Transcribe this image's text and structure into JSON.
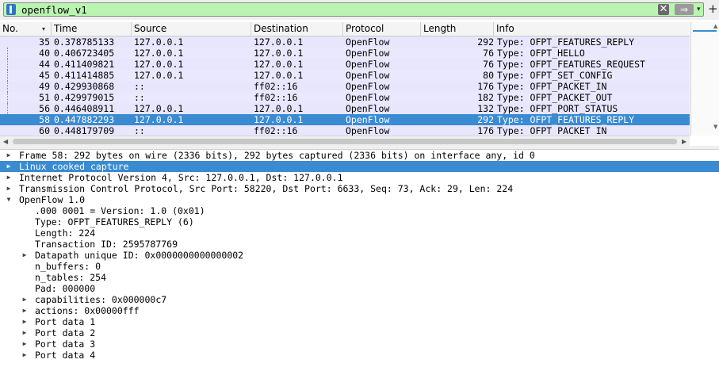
{
  "filter": {
    "value": "openflow_v1",
    "bookmark_icon": "bookmark-icon",
    "clear_glyph": "✕",
    "apply_glyph": "⇒",
    "dropdown_glyph": "▾",
    "plus_glyph": "+"
  },
  "packet_list": {
    "columns": [
      "No.",
      "Time",
      "Source",
      "Destination",
      "Protocol",
      "Length",
      "Info"
    ],
    "sort_glyph": "▾",
    "rows": [
      {
        "no": "35",
        "time": "0.378785133",
        "src": "127.0.0.1",
        "dst": "127.0.0.1",
        "proto": "OpenFlow",
        "len": "292",
        "info": "Type: OFPT_FEATURES_REPLY"
      },
      {
        "no": "40",
        "time": "0.406723405",
        "src": "127.0.0.1",
        "dst": "127.0.0.1",
        "proto": "OpenFlow",
        "len": "76",
        "info": "Type: OFPT_HELLO"
      },
      {
        "no": "44",
        "time": "0.411409821",
        "src": "127.0.0.1",
        "dst": "127.0.0.1",
        "proto": "OpenFlow",
        "len": "76",
        "info": "Type: OFPT_FEATURES_REQUEST"
      },
      {
        "no": "45",
        "time": "0.411414885",
        "src": "127.0.0.1",
        "dst": "127.0.0.1",
        "proto": "OpenFlow",
        "len": "80",
        "info": "Type: OFPT_SET_CONFIG"
      },
      {
        "no": "49",
        "time": "0.429930868",
        "src": "::",
        "dst": "ff02::16",
        "proto": "OpenFlow",
        "len": "176",
        "info": "Type: OFPT_PACKET_IN"
      },
      {
        "no": "51",
        "time": "0.429979015",
        "src": "::",
        "dst": "ff02::16",
        "proto": "OpenFlow",
        "len": "182",
        "info": "Type: OFPT_PACKET_OUT"
      },
      {
        "no": "56",
        "time": "0.446408911",
        "src": "127.0.0.1",
        "dst": "127.0.0.1",
        "proto": "OpenFlow",
        "len": "132",
        "info": "Type: OFPT_PORT_STATUS"
      },
      {
        "no": "58",
        "time": "0.447882293",
        "src": "127.0.0.1",
        "dst": "127.0.0.1",
        "proto": "OpenFlow",
        "len": "292",
        "info": "Type: OFPT_FEATURES_REPLY",
        "selected": true
      },
      {
        "no": "60",
        "time": "0.448179709",
        "src": "::",
        "dst": "ff02::16",
        "proto": "OpenFlow",
        "len": "176",
        "info": "Type: OFPT_PACKET_IN"
      }
    ]
  },
  "details": [
    {
      "level": 0,
      "expander": "collapsed",
      "text": "Frame 58: 292 bytes on wire (2336 bits), 292 bytes captured (2336 bits) on interface any, id 0"
    },
    {
      "level": 0,
      "expander": "collapsed",
      "text": "Linux cooked capture",
      "selected": true
    },
    {
      "level": 0,
      "expander": "collapsed",
      "text": "Internet Protocol Version 4, Src: 127.0.0.1, Dst: 127.0.0.1"
    },
    {
      "level": 0,
      "expander": "collapsed",
      "text": "Transmission Control Protocol, Src Port: 58220, Dst Port: 6633, Seq: 73, Ack: 29, Len: 224"
    },
    {
      "level": 0,
      "expander": "expanded",
      "text": "OpenFlow 1.0"
    },
    {
      "level": 1,
      "expander": "none",
      "text": ".000 0001 = Version: 1.0 (0x01)"
    },
    {
      "level": 1,
      "expander": "none",
      "text": "Type: OFPT_FEATURES_REPLY (6)"
    },
    {
      "level": 1,
      "expander": "none",
      "text": "Length: 224"
    },
    {
      "level": 1,
      "expander": "none",
      "text": "Transaction ID: 2595787769"
    },
    {
      "level": 1,
      "expander": "collapsed",
      "text": "Datapath unique ID: 0x0000000000000002"
    },
    {
      "level": 1,
      "expander": "none",
      "text": "n_buffers: 0"
    },
    {
      "level": 1,
      "expander": "none",
      "text": "n_tables: 254"
    },
    {
      "level": 1,
      "expander": "none",
      "text": "Pad: 000000"
    },
    {
      "level": 1,
      "expander": "collapsed",
      "text": "capabilities: 0x000000c7"
    },
    {
      "level": 1,
      "expander": "collapsed",
      "text": "actions: 0x00000fff"
    },
    {
      "level": 1,
      "expander": "collapsed",
      "text": "Port data 1"
    },
    {
      "level": 1,
      "expander": "collapsed",
      "text": "Port data 2"
    },
    {
      "level": 1,
      "expander": "collapsed",
      "text": "Port data 3"
    },
    {
      "level": 1,
      "expander": "collapsed",
      "text": "Port data 4"
    }
  ],
  "colors": {
    "filter_valid": "#b9f5b0",
    "selection": "#3a8bd1",
    "openflow_row": "#e7e6fd"
  }
}
